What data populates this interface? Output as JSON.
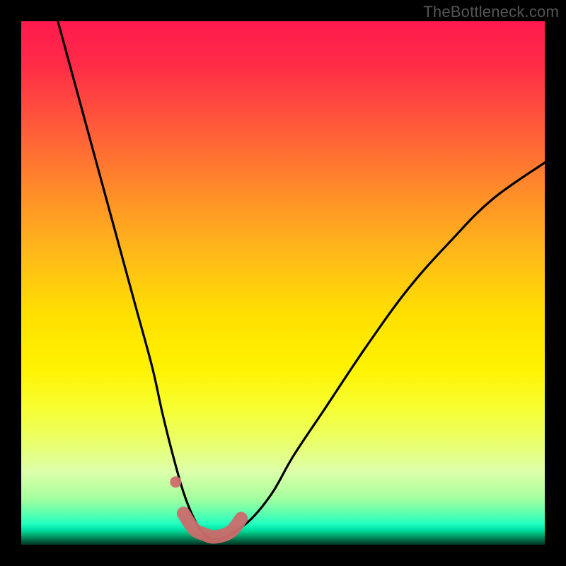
{
  "watermark": "TheBottleneck.com",
  "colors": {
    "frame": "#000000",
    "curve_stroke": "#000000",
    "highlight_stroke": "#cc6b6b",
    "watermark": "#555555"
  },
  "chart_data": {
    "type": "line",
    "title": "",
    "xlabel": "",
    "ylabel": "",
    "xlim": [
      0,
      100
    ],
    "ylim": [
      0,
      100
    ],
    "grid": false,
    "legend": false,
    "note": "Bottleneck-style V-curve over vertical red→yellow→green gradient. Values are read off the shape (no axis ticks present). x is horizontal position %, y is bottleneck/mismatch % (0 at bottom, 100 at top).",
    "series": [
      {
        "name": "bottleneck_curve",
        "x": [
          7,
          10,
          13,
          16,
          19,
          22,
          25,
          27,
          29,
          31,
          33,
          35,
          37,
          40,
          44,
          48,
          52,
          58,
          66,
          74,
          82,
          90,
          100
        ],
        "y": [
          100,
          89,
          78,
          67,
          56,
          45,
          34,
          25,
          17,
          10,
          5,
          2,
          1,
          2,
          5,
          10,
          17,
          26,
          38,
          49,
          58,
          66,
          73
        ]
      },
      {
        "name": "optimal_range_highlight",
        "x": [
          29.5,
          31,
          33,
          35,
          37,
          40,
          42
        ],
        "y": [
          12,
          6,
          3,
          2,
          1.5,
          2.5,
          5
        ]
      }
    ]
  }
}
